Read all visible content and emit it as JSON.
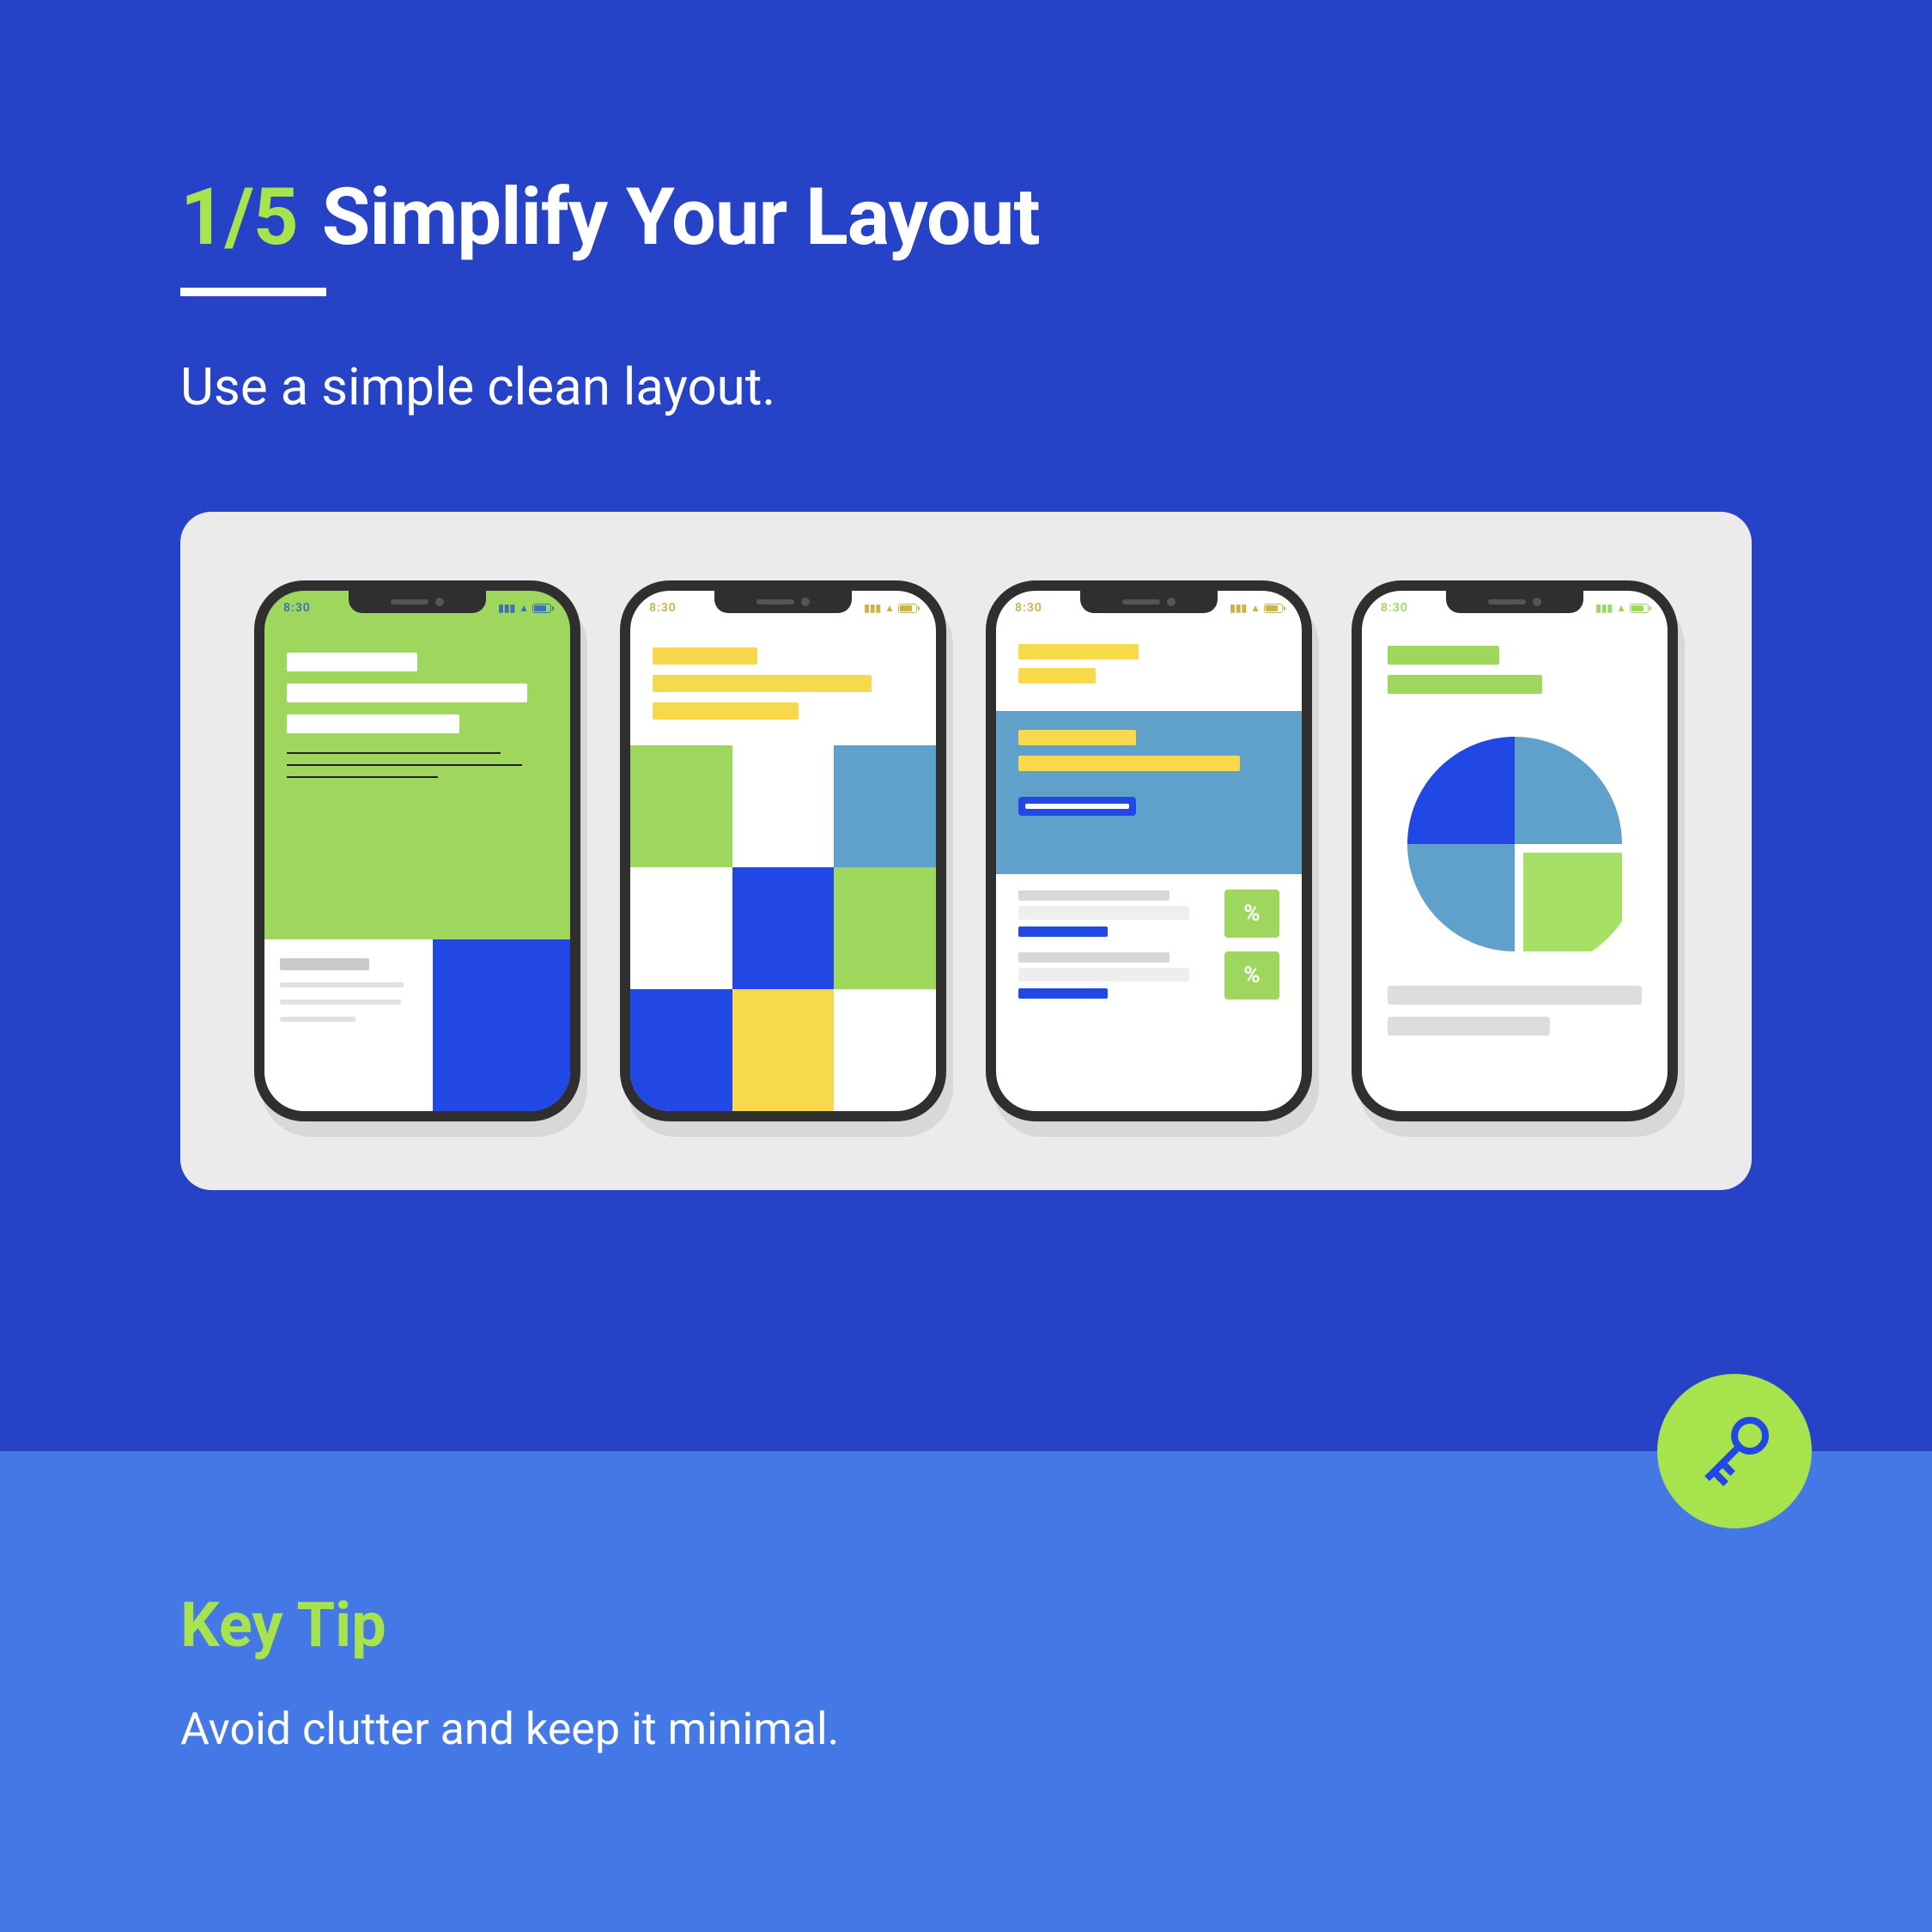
{
  "page": {
    "counter": "1/5",
    "title": "Simplify Your Layout",
    "subtitle": "Use a simple clean layout."
  },
  "tip": {
    "heading": "Key Tip",
    "text": "Avoid clutter and keep it minimal."
  },
  "phone": {
    "time": "8:30",
    "badge_percent": "%"
  },
  "colors": {
    "bg": "#2642c6",
    "panel": "#4378e6",
    "accent": "#a6e34c",
    "green": "#9fd75e",
    "yellow": "#f7d94b",
    "blue": "#2148e4",
    "lightblue": "#5fa1cb"
  }
}
